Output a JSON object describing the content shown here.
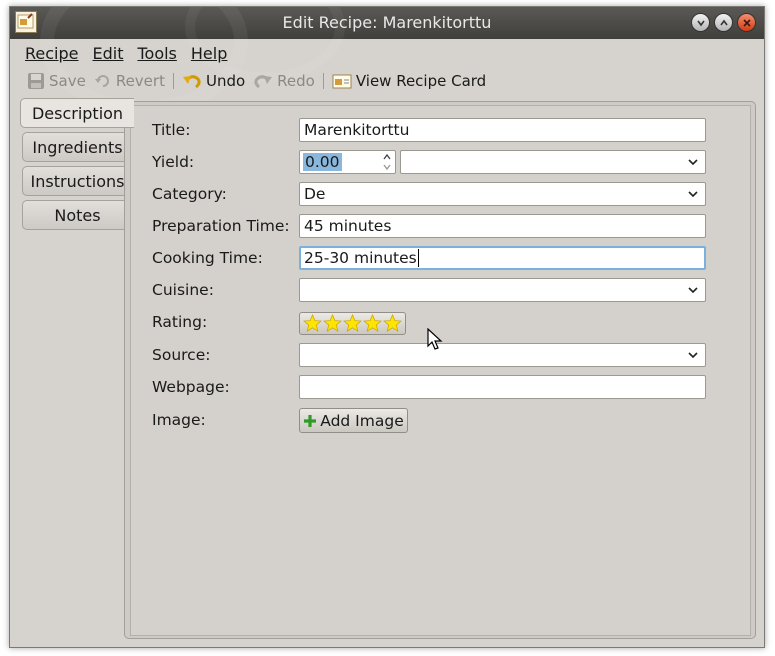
{
  "window": {
    "title": "Edit Recipe: Marenkitorttu",
    "app_icon": "recipe-card-icon",
    "controls": [
      "minimize-icon",
      "maximize-icon",
      "close-icon"
    ]
  },
  "menu": {
    "recipe": "Recipe",
    "edit": "Edit",
    "tools": "Tools",
    "help": "Help"
  },
  "toolbar": {
    "save": "Save",
    "revert": "Revert",
    "undo": "Undo",
    "redo": "Redo",
    "view_recipe_card": "View Recipe Card"
  },
  "tabs": {
    "description": "Description",
    "ingredients": "Ingredients",
    "instructions": "Instructions",
    "notes": "Notes",
    "active": "Description"
  },
  "form": {
    "title": {
      "label": "Title:",
      "value": "Marenkitorttu"
    },
    "yield": {
      "label": "Yield:",
      "value": "0.00",
      "unit": ""
    },
    "category": {
      "label": "Category:",
      "value": "De"
    },
    "prep_time": {
      "label": "Preparation Time:",
      "value": "45 minutes"
    },
    "cook_time": {
      "label": "Cooking Time:",
      "value": "25-30 minutes"
    },
    "cuisine": {
      "label": "Cuisine:",
      "value": ""
    },
    "rating": {
      "label": "Rating:",
      "stars": 5,
      "max": 5
    },
    "source": {
      "label": "Source:",
      "value": ""
    },
    "webpage": {
      "label": "Webpage:",
      "value": ""
    },
    "image": {
      "label": "Image:",
      "button": "Add Image"
    }
  },
  "colors": {
    "titlebar": "#4a4946",
    "window_bg": "#d6d2cd",
    "focus": "#7ab1dd",
    "selection": "#8ab7dc",
    "star": "#ffe400",
    "close_button": "#e0572f"
  }
}
